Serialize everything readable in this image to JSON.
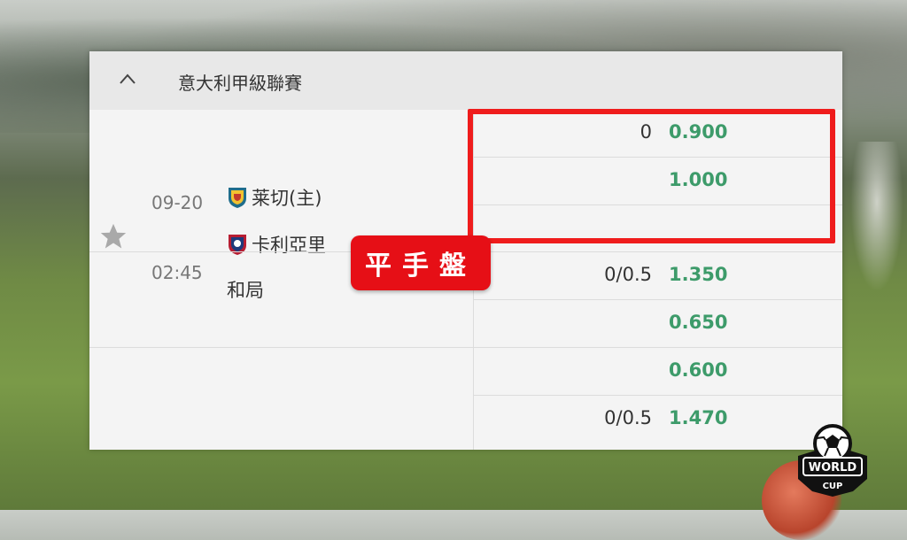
{
  "league": {
    "name": "意大利甲級聯賽"
  },
  "match": {
    "date": "09-20",
    "time": "02:45",
    "home_team": "莱切(主)",
    "away_team": "卡利亞里",
    "draw_label": "和局"
  },
  "odds_rows": [
    {
      "handicap": "0",
      "price": "0.900"
    },
    {
      "handicap": "",
      "price": "1.000"
    },
    {
      "handicap": "",
      "price": ""
    },
    {
      "handicap": "0/0.5",
      "price": "1.350"
    },
    {
      "handicap": "",
      "price": "0.650"
    },
    {
      "handicap": "",
      "price": "0.600"
    },
    {
      "handicap": "0/0.5",
      "price": "1.470"
    }
  ],
  "callout": {
    "label": "平手盤"
  },
  "logo": {
    "line1": "WORLD",
    "line2": "CUP"
  },
  "colors": {
    "price": "#3d9b6a",
    "highlight": "#ef1c1c",
    "callout_bg": "#e60f16"
  },
  "icons": {
    "collapse": "chevron-up-icon",
    "favorite": "star-icon"
  }
}
